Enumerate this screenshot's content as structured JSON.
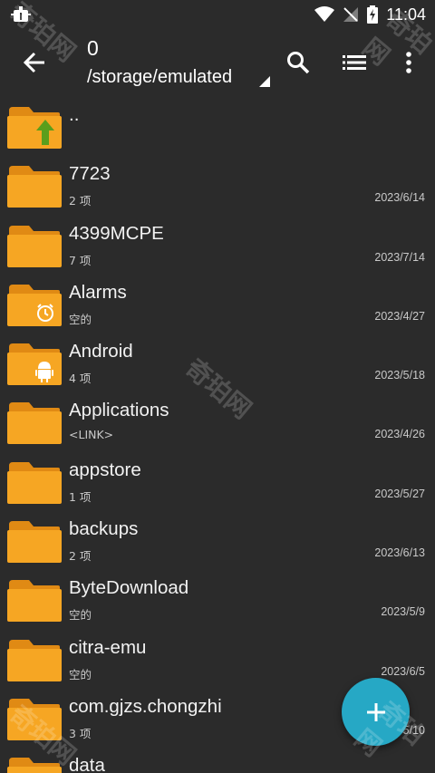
{
  "status": {
    "time": "11:04"
  },
  "toolbar": {
    "title": "0",
    "path": "/storage/emulated"
  },
  "icons": {
    "back": "arrow-back-icon",
    "search": "search-icon",
    "view": "list-view-icon",
    "more": "more-vert-icon",
    "fab": "add-icon"
  },
  "colors": {
    "folder": "#f6a623",
    "folder_tab": "#e08a14",
    "fab": "#26a8c5",
    "up_arrow": "#5a9e1c"
  },
  "files": [
    {
      "name": "..",
      "meta": "",
      "date": "",
      "badge": "up"
    },
    {
      "name": "7723",
      "meta": "2 项",
      "date": "2023/6/14",
      "badge": ""
    },
    {
      "name": "4399MCPE",
      "meta": "7 项",
      "date": "2023/7/14",
      "badge": ""
    },
    {
      "name": "Alarms",
      "meta": "空的",
      "date": "2023/4/27",
      "badge": "alarm"
    },
    {
      "name": "Android",
      "meta": "4 项",
      "date": "2023/5/18",
      "badge": "android"
    },
    {
      "name": "Applications",
      "meta": "<LINK>",
      "date": "2023/4/26",
      "badge": ""
    },
    {
      "name": "appstore",
      "meta": "1 项",
      "date": "2023/5/27",
      "badge": ""
    },
    {
      "name": "backups",
      "meta": "2 项",
      "date": "2023/6/13",
      "badge": ""
    },
    {
      "name": "ByteDownload",
      "meta": "空的",
      "date": "2023/5/9",
      "badge": ""
    },
    {
      "name": "citra-emu",
      "meta": "空的",
      "date": "2023/6/5",
      "badge": ""
    },
    {
      "name": "com.gjzs.chongzhi",
      "meta": "3 项",
      "date": "2023/5/10",
      "badge": ""
    },
    {
      "name": "data",
      "meta": "",
      "date": "",
      "badge": ""
    }
  ],
  "watermark": "奇珀网"
}
